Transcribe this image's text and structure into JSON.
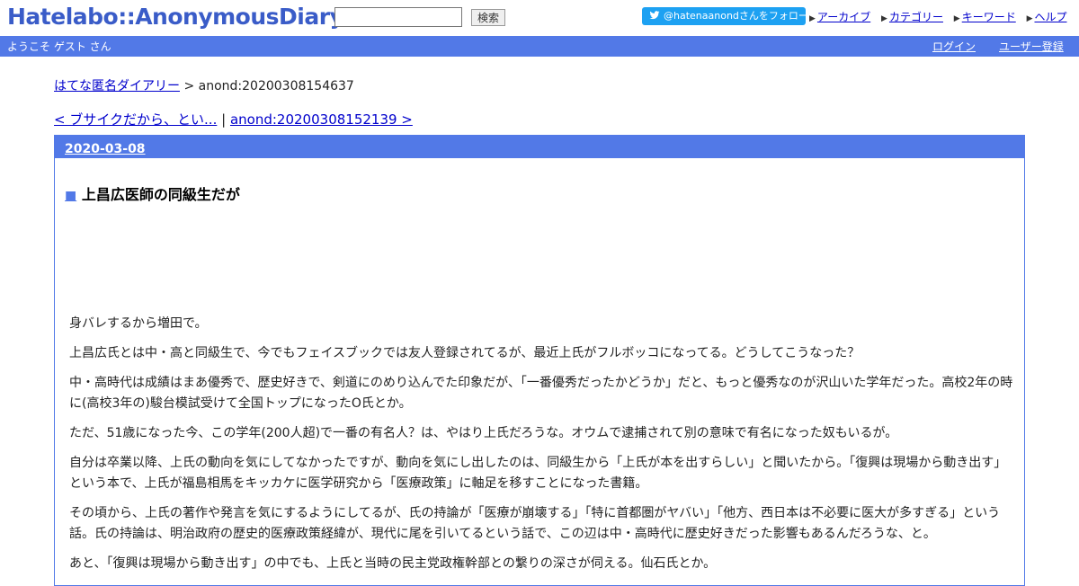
{
  "header": {
    "logo": "Hatelabo::AnonymousDiary",
    "search": {
      "value": "",
      "button_label": "検索"
    },
    "follow_button": "@hatenaanondさんをフォロー",
    "links": [
      "アーカイブ",
      "カテゴリー",
      "キーワード",
      "ヘルプ"
    ]
  },
  "userbar": {
    "welcome": "ようこそ ゲスト さん",
    "login": "ログイン",
    "register": "ユーザー登録"
  },
  "breadcrumb": {
    "home": "はてな匿名ダイアリー",
    "separator": ">",
    "current": "anond:20200308154637"
  },
  "nav": {
    "prev": "< ブサイクだから、とい...",
    "separator": "|",
    "next": "anond:20200308152139 >"
  },
  "entry": {
    "date": "2020-03-08",
    "marker": "■",
    "title": "上昌広医師の同級生だが",
    "paragraphs": [
      "身バレするから増田で。",
      "上昌広氏とは中・高と同級生で、今でもフェイスブックでは友人登録されてるが、最近上氏がフルボッコになってる。どうしてこうなった？",
      "中・高時代は成績はまあ優秀で、歴史好きで、剣道にのめり込んでた印象だが、「一番優秀だったかどうか」だと、もっと優秀なのが沢山いた学年だった。高校2年の時に(高校3年の)駿台模試受けて全国トップになったO氏とか。",
      "ただ、51歳になった今、この学年(200人超)で一番の有名人？は、やはり上氏だろうな。オウムで逮捕されて別の意味で有名になった奴もいるが。",
      "自分は卒業以降、上氏の動向を気にしてなかったですが、動向を気にし出したのは、同級生から「上氏が本を出すらしい」と聞いたから。「復興は現場から動き出す」という本で、上氏が福島相馬をキッカケに医学研究から「医療政策」に軸足を移すことになった書籍。",
      "その頃から、上氏の著作や発言を気にするようにしてるが、氏の持論が「医療が崩壊する」「特に首都圏がヤバい」「他方、西日本は不必要に医大が多すぎる」という話。氏の持論は、明治政府の歴史的医療政策経緯が、現代に尾を引いてるという話で、この辺は中・高時代に歴史好きだった影響もあるんだろうな、と。",
      "あと、「復興は現場から動き出す」の中でも、上氏と当時の民主党政権幹部との繋りの深さが伺える。仙石氏とか。"
    ]
  },
  "colors": {
    "brand_blue": "#5279e7",
    "logo_blue": "#3a5cc8",
    "twitter_blue": "#1da1f2",
    "link": "#0000cc"
  }
}
